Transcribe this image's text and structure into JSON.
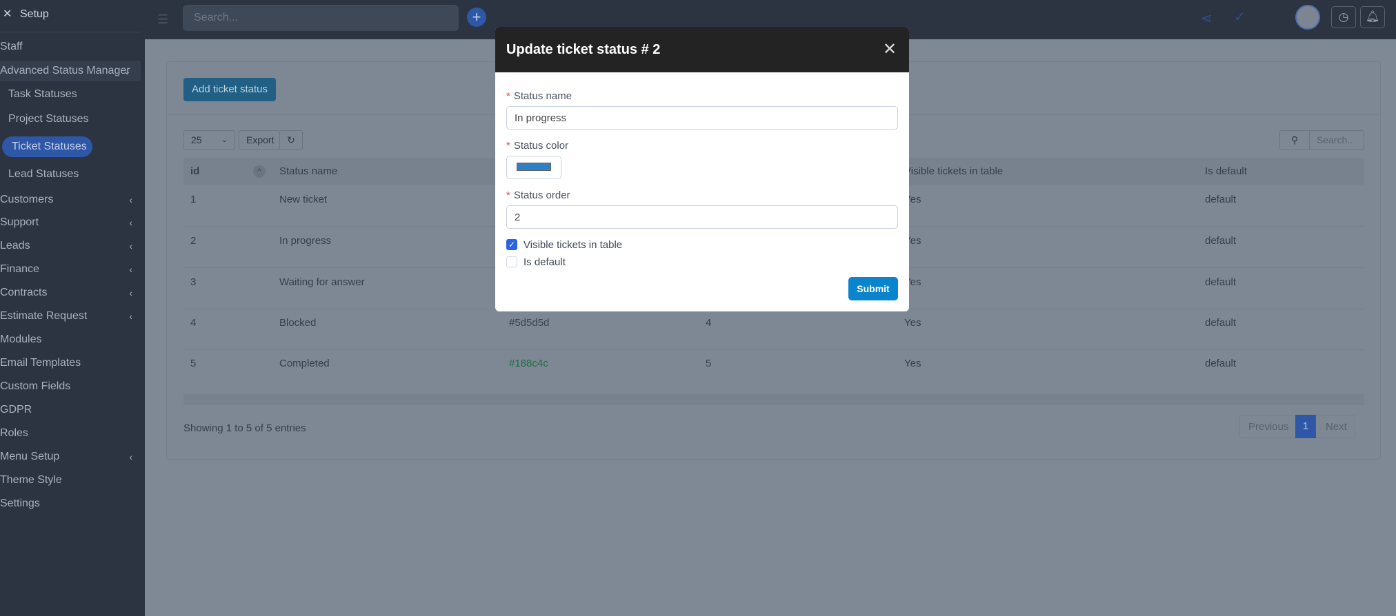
{
  "sidebar": {
    "title": "Setup",
    "items": [
      {
        "label": "Staff"
      },
      {
        "label": "Advanced Status Manager"
      },
      {
        "label": "Task Statuses"
      },
      {
        "label": "Project Statuses"
      },
      {
        "label": "Ticket Statuses"
      },
      {
        "label": "Lead Statuses"
      },
      {
        "label": "Customers"
      },
      {
        "label": "Support"
      },
      {
        "label": "Leads"
      },
      {
        "label": "Finance"
      },
      {
        "label": "Contracts"
      },
      {
        "label": "Estimate Request"
      },
      {
        "label": "Modules"
      },
      {
        "label": "Email Templates"
      },
      {
        "label": "Custom Fields"
      },
      {
        "label": "GDPR"
      },
      {
        "label": "Roles"
      },
      {
        "label": "Menu Setup"
      },
      {
        "label": "Theme Style"
      },
      {
        "label": "Settings"
      }
    ]
  },
  "topbar": {
    "search_placeholder": "Search..."
  },
  "main": {
    "add_button": "Add ticket status",
    "page_length": "25",
    "export": "Export",
    "table_search_placeholder": "Search..",
    "columns": [
      "id",
      "Status name",
      "Visible tickets in table",
      "Is default"
    ],
    "rows": [
      {
        "id": "1",
        "name": "New ticket",
        "color": "",
        "order": "",
        "visible": "Yes",
        "default": "default"
      },
      {
        "id": "2",
        "name": "In progress",
        "color": "",
        "order": "",
        "visible": "Yes",
        "default": "default"
      },
      {
        "id": "3",
        "name": "Waiting for answer",
        "color": "",
        "order": "",
        "visible": "Yes",
        "default": "default"
      },
      {
        "id": "4",
        "name": "Blocked",
        "color": "#5d5d5d",
        "order": "4",
        "visible": "Yes",
        "default": "default"
      },
      {
        "id": "5",
        "name": "Completed",
        "color": "#188c4c",
        "order": "5",
        "visible": "Yes",
        "default": "default"
      }
    ],
    "info": "Showing 1 to 5 of 5 entries",
    "prev": "Previous",
    "page": "1",
    "next": "Next"
  },
  "modal": {
    "title": "Update ticket status # 2",
    "name_label": "Status name",
    "name_value": "In progress",
    "color_label": "Status color",
    "color_value": "#2d7fc6",
    "order_label": "Status order",
    "order_value": "2",
    "visible_label": "Visible tickets in table",
    "visible_checked": true,
    "default_label": "Is default",
    "default_checked": false,
    "submit": "Submit"
  }
}
